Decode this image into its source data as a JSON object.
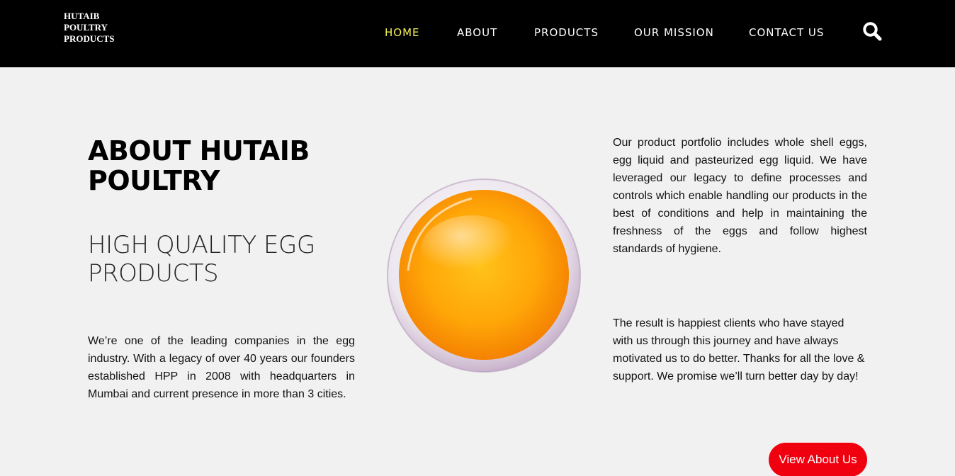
{
  "brand": {
    "logo_lines": [
      "HUTAIB",
      "POULTRY",
      "PRODUCTS"
    ]
  },
  "nav": {
    "items": [
      {
        "label": "HOME",
        "active": true
      },
      {
        "label": "ABOUT",
        "active": false
      },
      {
        "label": "PRODUCTS",
        "active": false
      },
      {
        "label": "OUR MISSION",
        "active": false
      },
      {
        "label": "CONTACT US",
        "active": false
      }
    ],
    "search_icon": "search-icon",
    "active_color": "#f4f05a"
  },
  "about": {
    "heading": "ABOUT HUTAIB POULTRY",
    "subheading": "HIGH QUALITY EGG PRODUCTS",
    "intro": "We’re one of the leading companies in the egg industry. With a legacy of over 40 years our founders established HPP in 2008 with headquarters in Mumbai and current presence in more than 3 cities.",
    "portfolio": "Our product portfolio includes whole shell eggs, egg liquid and pasteurized egg liquid. We have leveraged our legacy to define processes and controls which enable handling our products in the best of conditions and help in maintaining the freshness of the eggs and follow highest standards of hygiene.",
    "result": "The result is happiest clients who have stayed with us through this journey and have always motivated us to do better. Thanks for all the love & support. We promise we’ll turn better day by day!",
    "cta_label": "View About Us",
    "cta_color": "#f0000f"
  }
}
